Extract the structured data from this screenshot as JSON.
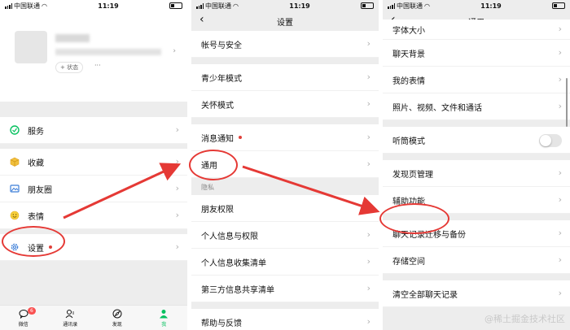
{
  "status": {
    "carrier": "中国联通",
    "time": "11:19"
  },
  "me": {
    "status_button": "+ 状态",
    "more": "···",
    "menu": [
      {
        "label": "服务"
      },
      {
        "label": "收藏"
      },
      {
        "label": "朋友圈"
      },
      {
        "label": "表情"
      },
      {
        "label": "设置"
      }
    ],
    "tabs": [
      {
        "label": "微信",
        "badge": "6"
      },
      {
        "label": "通讯录"
      },
      {
        "label": "发现"
      },
      {
        "label": "我"
      }
    ]
  },
  "settings": {
    "title": "设置",
    "account": "帐号与安全",
    "youth": "青少年模式",
    "care": "关怀模式",
    "notify": "消息通知",
    "general": "通用",
    "privacy_header": "隐私",
    "friend_perm": "朋友权限",
    "personal_perm": "个人信息与权限",
    "personal_list": "个人信息收集清单",
    "third_party": "第三方信息共享清单",
    "help": "帮助与反馈"
  },
  "general": {
    "title": "通用",
    "font_size": "字体大小",
    "chat_bg": "聊天背景",
    "stickers": "我的表情",
    "media": "照片、视频、文件和通话",
    "earpiece": "听筒模式",
    "earpiece_on": false,
    "discover": "发现页管理",
    "accessibility": "辅助功能",
    "migrate": "聊天记录迁移与备份",
    "storage": "存储空间",
    "clear": "清空全部聊天记录"
  },
  "watermark": "@稀土掘金技术社区",
  "colors": {
    "accent": "#07c160",
    "highlight": "#e53935",
    "badge": "#fa5151"
  }
}
